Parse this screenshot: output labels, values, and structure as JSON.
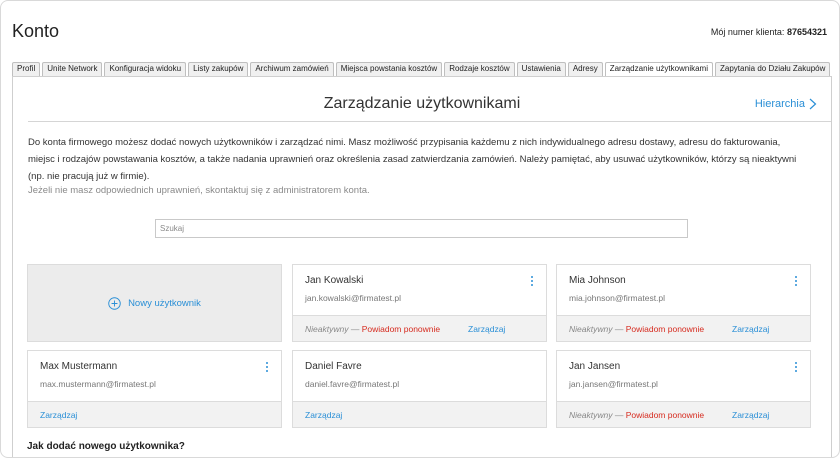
{
  "header": {
    "title": "Konto",
    "client_label": "Mój numer klienta:",
    "client_number": "87654321"
  },
  "tabs": [
    "Profil",
    "Unite Network",
    "Konfiguracja widoku",
    "Listy zakupów",
    "Archiwum zamówień",
    "Miejsca powstania kosztów",
    "Rodzaje kosztów",
    "Ustawienia",
    "Adresy",
    "Zarządzanie użytkownikami",
    "Zapytania do Działu Zakupów"
  ],
  "active_tab": "Zarządzanie użytkownikami",
  "page": {
    "heading": "Zarządzanie użytkownikami",
    "hierarchy_link": "Hierarchia",
    "intro": "Do konta firmowego możesz dodać nowych użytkowników i zarządzać nimi. Masz możliwość przypisania każdemu z nich indywidualnego adresu dostawy, adresu do fakturowania, miejsc i rodzajów powstawania kosztów, a także nadania uprawnień oraz określenia zasad zatwierdzania zamówień. Należy pamiętać, aby usuwać użytkowników, którzy są nieaktywni (np. nie pracują już w firmie).",
    "note": "Jeżeli nie masz odpowiednich uprawnień, skontaktuj się z administratorem konta.",
    "search_placeholder": "Szukaj",
    "new_user_label": "Nowy użytkownik",
    "howto_heading": "Jak dodać nowego użytkownika?"
  },
  "labels": {
    "inactive": "Nieaktywny",
    "dash": " — ",
    "resend": "Powiadom ponownie",
    "manage": "Zarządzaj"
  },
  "users": [
    {
      "name": "Jan Kowalski",
      "email": "jan.kowalski@firmatest.pl",
      "inactive": true
    },
    {
      "name": "Mia Johnson",
      "email": "mia.johnson@firmatest.pl",
      "inactive": true
    },
    {
      "name": "Max Mustermann",
      "email": "max.mustermann@firmatest.pl",
      "inactive": false
    },
    {
      "name": "Daniel Favre",
      "email": "daniel.favre@firmatest.pl",
      "inactive": false
    },
    {
      "name": "Jan Jansen",
      "email": "jan.jansen@firmatest.pl",
      "inactive": true
    }
  ],
  "colors": {
    "accent": "#2a8fd6",
    "danger": "#d62b1f",
    "muted": "#888888"
  }
}
